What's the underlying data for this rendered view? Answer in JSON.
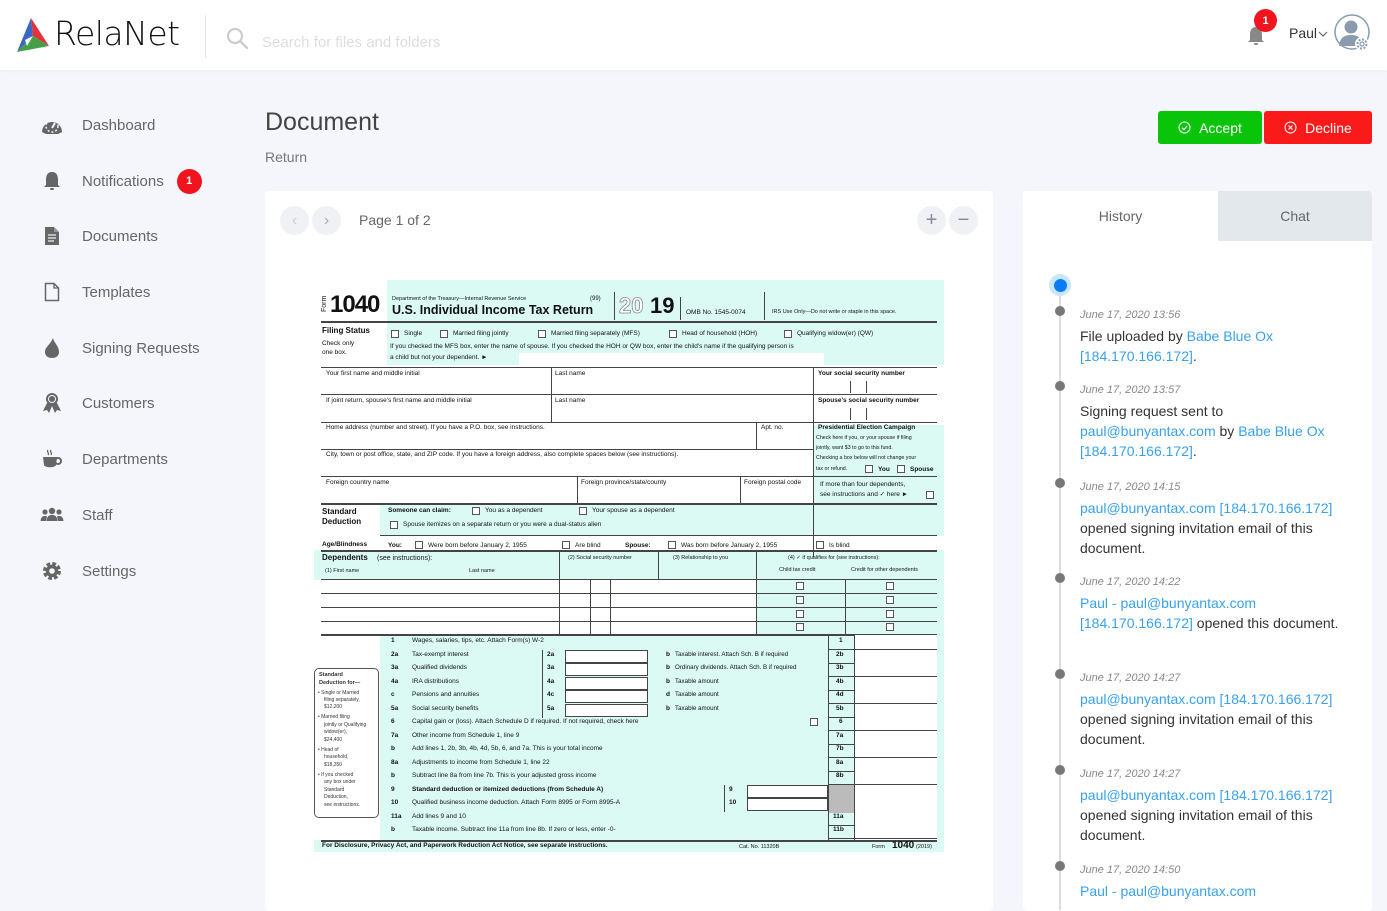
{
  "app": {
    "name": "RelaNet"
  },
  "search": {
    "placeholder": "Search for files and folders"
  },
  "header": {
    "notification_count": "1",
    "user_name": "Paul"
  },
  "sidebar": {
    "items": [
      {
        "label": "Dashboard",
        "icon": "dashboard-icon"
      },
      {
        "label": "Notifications",
        "icon": "bell-icon",
        "badge": "1"
      },
      {
        "label": "Documents",
        "icon": "document-icon"
      },
      {
        "label": "Templates",
        "icon": "template-icon"
      },
      {
        "label": "Signing Requests",
        "icon": "flame-icon"
      },
      {
        "label": "Customers",
        "icon": "award-icon"
      },
      {
        "label": "Departments",
        "icon": "coffee-icon"
      },
      {
        "label": "Staff",
        "icon": "users-icon"
      },
      {
        "label": "Settings",
        "icon": "gear-icon"
      }
    ]
  },
  "page": {
    "title": "Document",
    "subtitle": "Return"
  },
  "actions": {
    "accept": "Accept",
    "decline": "Decline"
  },
  "colors": {
    "accept": "#0ac40a",
    "decline": "#fb1a1a",
    "link": "#3aa0ec",
    "badge": "#f0141e"
  },
  "viewer": {
    "page_indicator": "Page 1 of 2",
    "prev": "‹",
    "next": "›",
    "zoom_in": "+",
    "zoom_out": "−"
  },
  "form": {
    "form_label": "Form",
    "form_no": "1040",
    "agency": "Department of the Treasury—Internal Revenue Service",
    "code": "(99)",
    "title": "U.S. Individual Income Tax Return",
    "year_outline": "20",
    "year_bold": "19",
    "omb": "OMB No. 1545-0074",
    "irs_use": "IRS Use Only—Do not write or staple in this space.",
    "filing_status": "Filing Status",
    "check_one": "Check only",
    "check_one2": "one box.",
    "fs_options": [
      "Single",
      "Married filing jointly",
      "Married filing separately (MFS)",
      "Head of household (HOH)",
      "Qualifying widow(er) (QW)"
    ],
    "mfs_note": "If you checked the MFS box, enter the name of spouse. If you checked the HOH or QW box, enter the child's name if the qualifying person is",
    "mfs_note2": "a child but not your dependent. ►",
    "first_name": "Your first name and middle initial",
    "last_name": "Last name",
    "ssn": "Your social security number",
    "spouse_first": "If joint return, spouse's first name and middle initial",
    "spouse_last": "Last name",
    "spouse_ssn": "Spouse's social security number",
    "home_address": "Home address (number and street). If you have a P.O. box, see instructions.",
    "apt": "Apt. no.",
    "pec_title": "Presidential Election Campaign",
    "pec_lines": [
      "Check here if you, or your spouse if filing",
      "jointly, want $3 to go to this fund.",
      "Checking a box below will not change your",
      "tax or refund."
    ],
    "pec_you": "You",
    "pec_spouse": "Spouse",
    "city": "City, town or post office, state, and ZIP code. If you have a foreign address, also complete spaces below (see instructions).",
    "foreign_country": "Foreign country name",
    "foreign_province": "Foreign province/state/county",
    "foreign_postal": "Foreign postal code",
    "four_dep": "If more than four dependents,",
    "four_dep2": "see instructions and ✓ here ►",
    "std_ded": "Standard",
    "std_ded2": "Deduction",
    "someone_claim": "Someone can claim:",
    "you_dep": "You as a dependent",
    "spouse_dep": "Your spouse as a dependent",
    "spouse_itemizes": "Spouse itemizes on a separate return or you were a dual-status alien",
    "age_blind": "Age/Blindness",
    "you": "You:",
    "born_before": "Were born before January 2, 1955",
    "are_blind": "Are blind",
    "spouse": "Spouse:",
    "spouse_born": "Was born before January 2, 1955",
    "is_blind": "Is blind",
    "dependents": "Dependents",
    "see_instr": "(see instructions):",
    "dep_c1": "(1) First name",
    "dep_c1b": "Last name",
    "dep_c2": "(2) Social security number",
    "dep_c3": "(3) Relationship to you",
    "dep_c4": "(4) ✓ if qualifies for (see instructions):",
    "dep_c4a": "Child tax credit",
    "dep_c4b": "Credit for other dependents",
    "sd_box": [
      "Standard",
      "Deduction for—",
      "• Single or Married",
      "filing separately,",
      "$12,200",
      "• Married filing",
      "jointly or Qualifying",
      "widow(er),",
      "$24,400",
      "• Head of",
      "household,",
      "$18,350",
      "• If you checked",
      "any box under",
      "Standard",
      "Deduction,",
      "see instructions."
    ],
    "lines": [
      {
        "n": "1",
        "text": "Wages, salaries, tips, etc. Attach Form(s) W-2",
        "box": "1"
      },
      {
        "n": "2a",
        "text": "Tax-exempt interest",
        "mid": "2a",
        "b": "b",
        "btext": "Taxable interest. Attach Sch. B if required",
        "box": "2b"
      },
      {
        "n": "3a",
        "text": "Qualified dividends",
        "mid": "3a",
        "b": "b",
        "btext": "Ordinary dividends. Attach Sch. B if required",
        "box": "3b"
      },
      {
        "n": "4a",
        "text": "IRA distributions",
        "mid": "4a",
        "b": "b",
        "btext": "Taxable amount",
        "box": "4b"
      },
      {
        "n": "c",
        "text": "Pensions and annuities",
        "mid": "4c",
        "b": "d",
        "btext": "Taxable amount",
        "box": "4d"
      },
      {
        "n": "5a",
        "text": "Social security benefits",
        "mid": "5a",
        "b": "b",
        "btext": "Taxable amount",
        "box": "5b"
      },
      {
        "n": "6",
        "text": "Capital gain or (loss). Attach Schedule D if required. If not required, check here",
        "box": "6"
      },
      {
        "n": "7a",
        "text": "Other income from Schedule 1, line 9",
        "box": "7a"
      },
      {
        "n": "b",
        "text": "Add lines 1, 2b, 3b, 4b, 4d, 5b, 6, and 7a. This is your total income",
        "box": "7b"
      },
      {
        "n": "8a",
        "text": "Adjustments to income from Schedule 1, line 22",
        "box": "8a"
      },
      {
        "n": "b",
        "text": "Subtract line 8a from line 7b. This is your adjusted gross income",
        "box": "8b"
      },
      {
        "n": "9",
        "text": "Standard deduction or itemized deductions (from Schedule A)",
        "mid": "9"
      },
      {
        "n": "10",
        "text": "Qualified business income deduction. Attach Form 8995 or Form 8995-A",
        "mid": "10"
      },
      {
        "n": "11a",
        "text": "Add lines 9 and 10",
        "box": "11a"
      },
      {
        "n": "b",
        "text": "Taxable income. Subtract line 11a from line 8b. If zero or less, enter -0-",
        "box": "11b"
      }
    ],
    "footer_notice": "For Disclosure, Privacy Act, and Paperwork Reduction Act Notice, see separate instructions.",
    "cat_no": "Cat. No. 11320B",
    "footer_form": "Form",
    "footer_no": "1040",
    "footer_year": "(2019)"
  },
  "tabs": {
    "history": "History",
    "chat": "Chat"
  },
  "history": [
    {
      "date": "June 17, 2020 13:56",
      "parts": [
        {
          "t": "File uploaded by "
        },
        {
          "l": "Babe Blue Ox"
        },
        {
          "t": " "
        },
        {
          "l": "[184.170.166.172]"
        },
        {
          "t": "."
        }
      ]
    },
    {
      "date": "June 17, 2020 13:57",
      "parts": [
        {
          "t": "Signing request sent to "
        },
        {
          "l": "paul@bunyantax.com"
        },
        {
          "t": " by "
        },
        {
          "l": "Babe Blue Ox"
        },
        {
          "t": " "
        },
        {
          "l": "[184.170.166.172]"
        },
        {
          "t": "."
        }
      ]
    },
    {
      "date": "June 17, 2020 14:15",
      "parts": [
        {
          "l": "paul@bunyantax.com"
        },
        {
          "t": " "
        },
        {
          "l": "[184.170.166.172]"
        },
        {
          "t": " opened signing invitation email of this document."
        }
      ]
    },
    {
      "date": "June 17, 2020 14:22",
      "parts": [
        {
          "l": "Paul - paul@bunyantax.com"
        },
        {
          "t": " "
        },
        {
          "l": "[184.170.166.172]"
        },
        {
          "t": " opened this document."
        }
      ]
    },
    {
      "date": "June 17, 2020 14:27",
      "parts": [
        {
          "l": "paul@bunyantax.com"
        },
        {
          "t": " "
        },
        {
          "l": "[184.170.166.172]"
        },
        {
          "t": " opened signing invitation email of this document."
        }
      ]
    },
    {
      "date": "June 17, 2020 14:27",
      "parts": [
        {
          "l": "paul@bunyantax.com"
        },
        {
          "t": " "
        },
        {
          "l": "[184.170.166.172]"
        },
        {
          "t": " opened signing invitation email of this document."
        }
      ]
    },
    {
      "date": "June 17, 2020 14:50",
      "parts": [
        {
          "l": "Paul - paul@bunyantax.com"
        }
      ]
    }
  ]
}
